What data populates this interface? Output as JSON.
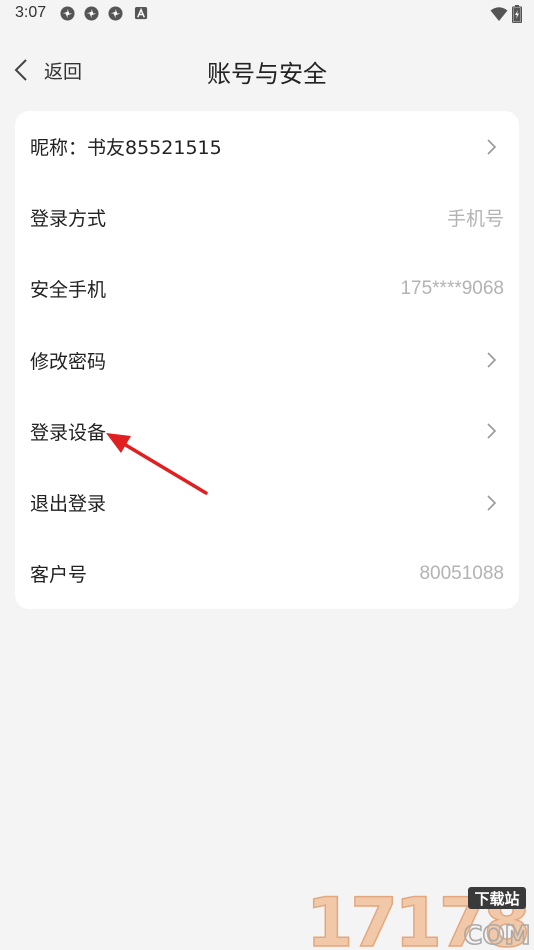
{
  "status_bar": {
    "time": "3:07",
    "app_icons": [
      "pinwheel-icon",
      "pinwheel-icon",
      "pinwheel-icon",
      "a-box-icon"
    ],
    "right_icons": [
      "wifi-icon",
      "battery-charging-icon"
    ]
  },
  "header": {
    "back_label": "返回",
    "title": "账号与安全"
  },
  "rows": [
    {
      "label": "昵称：书友85521515",
      "value": "",
      "has_chevron": true
    },
    {
      "label": "登录方式",
      "value": "手机号",
      "has_chevron": false
    },
    {
      "label": "安全手机",
      "value": "175****9068",
      "has_chevron": false
    },
    {
      "label": "修改密码",
      "value": "",
      "has_chevron": true
    },
    {
      "label": "登录设备",
      "value": "",
      "has_chevron": true
    },
    {
      "label": "退出登录",
      "value": "",
      "has_chevron": true
    },
    {
      "label": "客户号",
      "value": "80051088",
      "has_chevron": false
    }
  ],
  "annotation": {
    "color": "#e02020",
    "target": "登录设备"
  },
  "watermark": {
    "number": "17178",
    "tag": "下载站",
    "domain": "COM"
  },
  "colors": {
    "background": "#f4f4f5",
    "card": "#ffffff",
    "muted_text": "#b3b3b3"
  }
}
